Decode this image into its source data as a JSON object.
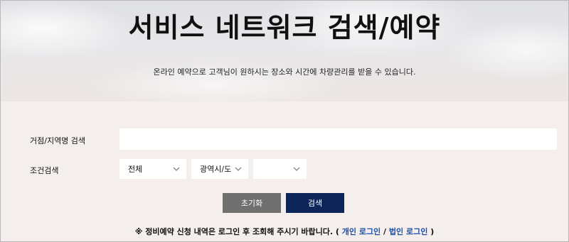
{
  "hero": {
    "title": "서비스 네트워크 검색/예약",
    "subtitle": "온라인 예약으로 고객님이 원하시는 장소와 시간에 차량관리를 받을 수 있습니다."
  },
  "form": {
    "location_label": "거점/지역명 검색",
    "location_value": "",
    "condition_label": "조건검색",
    "select_type": "전체",
    "select_region": "광역시/도",
    "select_district": ""
  },
  "buttons": {
    "reset_label": "초기화",
    "search_label": "검색"
  },
  "notice": {
    "prefix": "※ 정비예약 신청 내역은 로그인 후 조회해 주시기 바랍니다. (",
    "personal_login": "개인 로그인",
    "separator": "/",
    "corporate_login": "법인 로그인",
    "suffix": ")"
  },
  "colors": {
    "search_button": "#0d2559",
    "reset_button": "#707070",
    "link": "#1e4fa8",
    "form_background": "#f4efed"
  },
  "icons": {
    "dropdown": "chevron-down-icon"
  }
}
